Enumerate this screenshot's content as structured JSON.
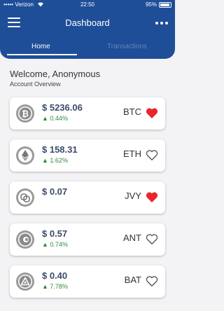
{
  "status_bar": {
    "carrier": "Verizon",
    "time": "22:50",
    "battery": "95%"
  },
  "header": {
    "title": "Dashboard"
  },
  "tabs": [
    {
      "label": "Home",
      "active": true
    },
    {
      "label": "Transactions",
      "active": false
    }
  ],
  "welcome": {
    "greeting": "Welcome, Anonymous",
    "subtitle": "Account Overview"
  },
  "colors": {
    "header": "#1e4e98",
    "favorite": "#e8262b",
    "positive": "#2e8b3a"
  },
  "coins": [
    {
      "icon": "bitcoin-icon",
      "price": "$ 5236.06",
      "change": "0.44%",
      "symbol": "BTC",
      "favorite": true
    },
    {
      "icon": "ethereum-icon",
      "price": "$ 158.31",
      "change": "1.62%",
      "symbol": "ETH",
      "favorite": false
    },
    {
      "icon": "jvy-icon",
      "price": "$ 0.07",
      "change": "",
      "symbol": "JVY",
      "favorite": true
    },
    {
      "icon": "ant-icon",
      "price": "$ 0.57",
      "change": "0.74%",
      "symbol": "ANT",
      "favorite": false
    },
    {
      "icon": "bat-icon",
      "price": "$ 0.40",
      "change": "7.78%",
      "symbol": "BAT",
      "favorite": false
    }
  ]
}
